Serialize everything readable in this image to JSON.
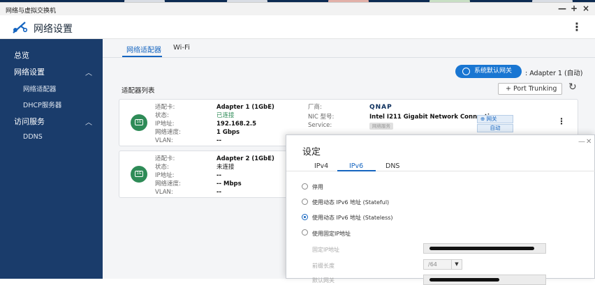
{
  "window": {
    "title": "网络与虚拟交换机",
    "controls": [
      "—",
      "+",
      "×"
    ]
  },
  "header": {
    "app_icon": "network-settings-icon",
    "title": "网络设置",
    "menu_icon": "kebab-menu-icon"
  },
  "sidebar": {
    "items": [
      {
        "label": "总览"
      },
      {
        "label": "网络设置",
        "expanded": true
      },
      {
        "label": "网络适配器"
      },
      {
        "label": "DHCP服务器"
      },
      {
        "label": "访问服务",
        "expanded": true
      },
      {
        "label": "DDNS"
      }
    ]
  },
  "tabs": [
    {
      "label": "网络适配器",
      "active": true
    },
    {
      "label": "Wi-Fi",
      "active": false
    }
  ],
  "toolbar": {
    "default_gateway_button": "系统默认网关",
    "default_gateway_value": ": Adapter 1 (自动)",
    "list_title": "适配器列表",
    "port_trunking_button": "+  Port Trunking",
    "refresh_icon": "refresh-icon"
  },
  "adapters": [
    {
      "icon_text": "1G",
      "labels": [
        "适配卡:",
        "状态:",
        "IP地址:",
        "网络速度:",
        "VLAN:"
      ],
      "values": [
        "Adapter 1 (1GbE)",
        "已连接",
        "192.168.2.5",
        "1 Gbps",
        "--"
      ],
      "status_color": "#2e8b57",
      "labels2": [
        "厂商:",
        "NIC 型号:",
        "Service:"
      ],
      "vendor": "QNAP",
      "nic_model": "Intel I211 Gigabit Network Connection",
      "service": "网络服务",
      "gateway_badge": "网关",
      "auto_badge": "自动"
    },
    {
      "icon_text": "1G",
      "labels": [
        "适配卡:",
        "状态:",
        "IP地址:",
        "网络速度:",
        "VLAN:"
      ],
      "values": [
        "Adapter 2 (1GbE)",
        "未连接",
        "--",
        "-- Mbps",
        "--"
      ]
    }
  ],
  "dialog": {
    "title": "设定",
    "tabs": [
      {
        "label": "IPv4",
        "active": false
      },
      {
        "label": "IPv6",
        "active": true
      },
      {
        "label": "DNS",
        "active": false
      }
    ],
    "options": [
      {
        "label": "停用",
        "selected": false
      },
      {
        "label": "使用动态 IPv6 地址 (Stateful)",
        "selected": false
      },
      {
        "label": "使用动态 IPv6 地址 (Stateless)",
        "selected": true
      },
      {
        "label": "使用固定IP地址",
        "selected": false
      }
    ],
    "fixed_fields": [
      {
        "label": "固定IP地址"
      },
      {
        "label": "前缀长度",
        "value": "/64"
      },
      {
        "label": "默认网关"
      }
    ]
  },
  "colors": {
    "sidebar_bg": "#1a3c6b",
    "accent": "#1565c0",
    "connected": "#2e8b57"
  }
}
